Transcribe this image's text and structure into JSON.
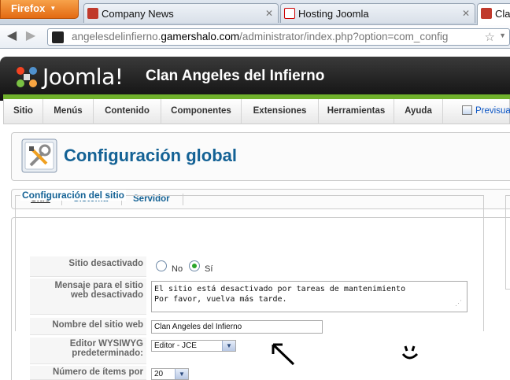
{
  "browser": {
    "menu_button": "Firefox",
    "tabs": [
      {
        "title": "Company News"
      },
      {
        "title": "Hosting Joomla"
      },
      {
        "title": "Clan"
      }
    ],
    "url": {
      "prefix": "angelesdelinfierno.",
      "host": "gamershalo.com",
      "path": "/administrator/index.php?option=com_config"
    }
  },
  "header": {
    "logo_text": "Joomla!",
    "site_name": "Clan Angeles del Infierno"
  },
  "menu": {
    "items": [
      "Sitio",
      "Menús",
      "Contenido",
      "Componentes",
      "Extensiones",
      "Herramientas",
      "Ayuda"
    ],
    "preview": "Previsual"
  },
  "page_title": "Configuración global",
  "subtabs": [
    "Sitio",
    "Sistema",
    "Servidor"
  ],
  "form": {
    "legend": "Configuración del sitio",
    "site_offline": {
      "label": "Sitio desactivado",
      "options": [
        "No",
        "Sí"
      ],
      "selected": "Sí"
    },
    "offline_message": {
      "label_line1": "Mensaje para el sitio",
      "label_line2": "web desactivado",
      "value": "El sitio está desactivado por tareas de mantenimiento\nPor favor, vuelva más tarde."
    },
    "site_name": {
      "label": "Nombre del sitio web",
      "value": "Clan Angeles del Infierno"
    },
    "editor": {
      "label_line1": "Editor WYSIWYG",
      "label_line2": "predeterminado:",
      "value": "Editor - JCE"
    },
    "list_length": {
      "label": "Número de ítems por",
      "value": "20"
    }
  },
  "colors": {
    "joomla_green": "#6fb02b",
    "title_blue": "#146295",
    "firefox_orange": "#e36a12"
  }
}
